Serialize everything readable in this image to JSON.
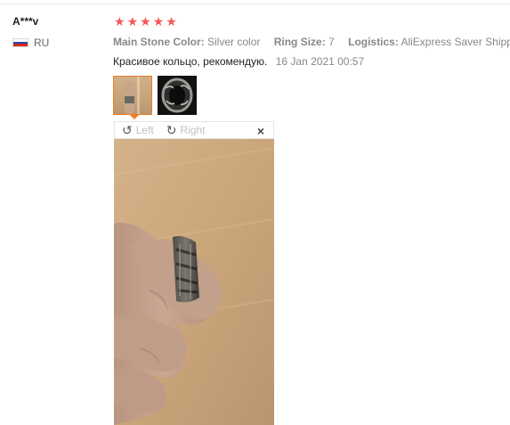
{
  "reviewer": {
    "name": "A***v",
    "country": "RU"
  },
  "rating": {
    "stars": 5,
    "star_glyph": "★",
    "color": "#f45757"
  },
  "attributes": [
    {
      "key": "Main Stone Color:",
      "value": "Silver color"
    },
    {
      "key": "Ring Size:",
      "value": "7"
    },
    {
      "key": "Logistics:",
      "value": "AliExpress Saver Shipping"
    }
  ],
  "review": {
    "text": "Красивое кольцо, рекомендую.",
    "date": "16 Jan 2021 00:57"
  },
  "viewer": {
    "rotate_left_label": "Left",
    "rotate_right_label": "Right",
    "close_glyph": "×",
    "rotate_left_icon": "rotate-left-icon",
    "rotate_right_icon": "rotate-right-icon"
  },
  "colors": {
    "accent": "#f07c24",
    "star": "#f45757"
  }
}
